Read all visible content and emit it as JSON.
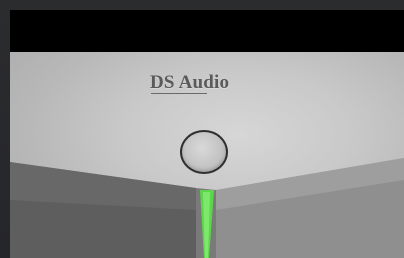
{
  "device": {
    "brand_logo": "DS Audio",
    "power_button_icon": "circle-button-icon",
    "indicator_color": "#5cd64a"
  }
}
